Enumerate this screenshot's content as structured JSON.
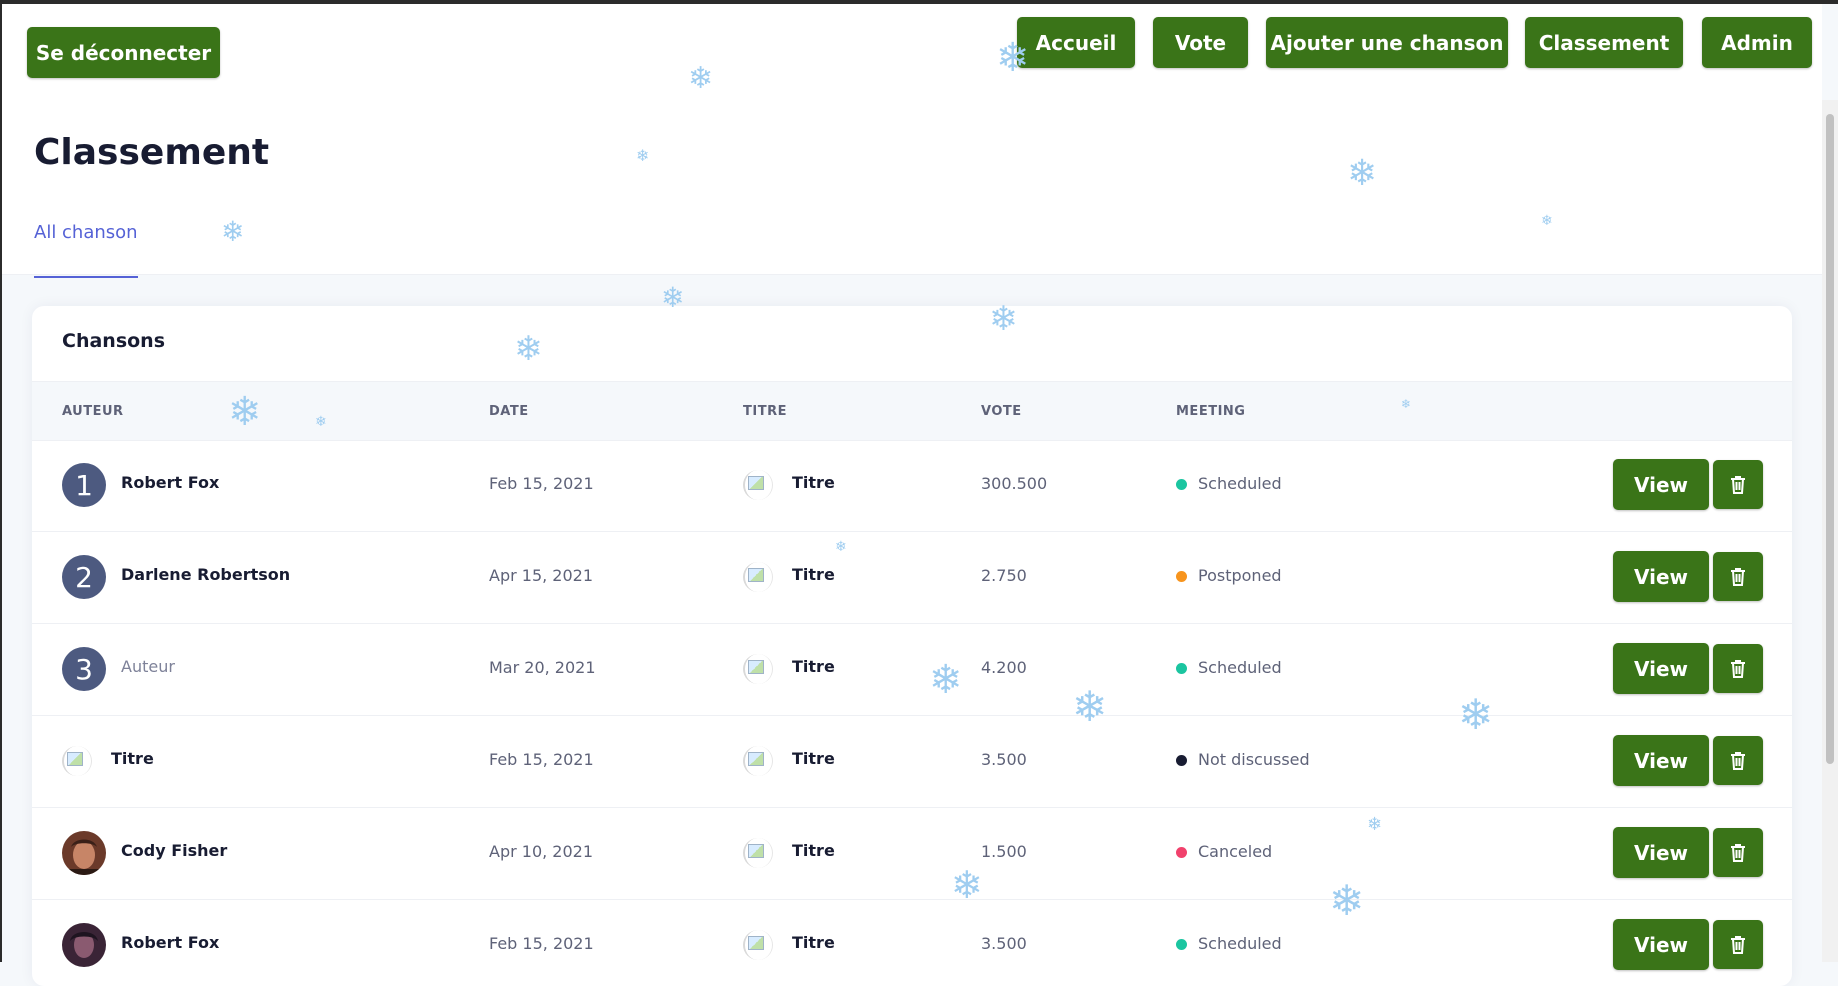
{
  "header": {
    "logout_label": "Se déconnecter",
    "nav": [
      "Accueil",
      "Vote",
      "Ajouter une chanson",
      "Classement",
      "Admin"
    ]
  },
  "page": {
    "title": "Classement",
    "tab": "All chanson"
  },
  "card": {
    "title": "Chansons",
    "columns": [
      "AUTEUR",
      "DATE",
      "TITRE",
      "VOTE",
      "MEETING"
    ],
    "rows": [
      {
        "rank": "1",
        "author": "Robert Fox",
        "date": "Feb 15, 2021",
        "title": "Titre",
        "vote": "300.500",
        "status": "Scheduled",
        "status_color": "#1bc5a0"
      },
      {
        "rank": "2",
        "author": "Darlene Robertson",
        "date": "Apr 15, 2021",
        "title": "Titre",
        "vote": "2.750",
        "status": "Postponed",
        "status_color": "#f7941d"
      },
      {
        "rank": "3",
        "author": "Auteur",
        "date": "Mar 20, 2021",
        "title": "Titre",
        "vote": "4.200",
        "status": "Scheduled",
        "status_color": "#1bc5a0"
      },
      {
        "author": "Titre",
        "date": "Feb 15, 2021",
        "title": "Titre",
        "vote": "3.500",
        "status": "Not discussed",
        "status_color": "#181c32"
      },
      {
        "author": "Cody Fisher",
        "date": "Apr 10, 2021",
        "title": "Titre",
        "vote": "1.500",
        "status": "Canceled",
        "status_color": "#f1416c"
      },
      {
        "author": "Robert Fox",
        "date": "Feb 15, 2021",
        "title": "Titre",
        "vote": "3.500",
        "status": "Scheduled",
        "status_color": "#1bc5a0"
      }
    ],
    "view_label": "View",
    "delete_icon": "trash-icon"
  },
  "colors": {
    "accent": "#3a7418",
    "tab_active": "#5562d6",
    "snowflake": "#9fcdf0"
  },
  "decor_icon": "snowflake-icon"
}
